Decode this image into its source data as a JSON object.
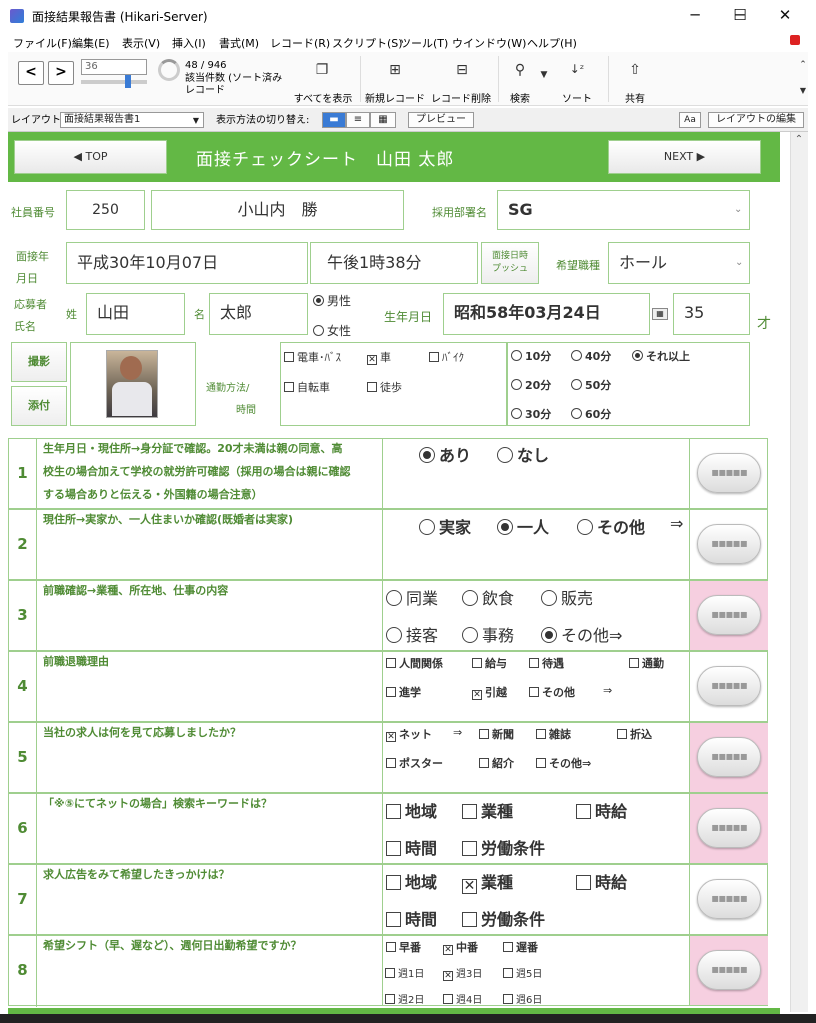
{
  "window": {
    "title": "面接結果報告書 (Hikari-Server)",
    "min": "─",
    "max": "☐",
    "close": "✕"
  },
  "menu": [
    "ファイル(F)",
    "編集(E)",
    "表示(V)",
    "挿入(I)",
    "書式(M)",
    "レコード(R)",
    "スクリプト(S)",
    "ツール(T)",
    "ウインドウ(W)",
    "ヘルプ(H)"
  ],
  "toolbar": {
    "prev": "<",
    "next": ">",
    "record_input": "36",
    "record_count": "48 / 946",
    "found_label": "該当件数 (ソート済み",
    "record_label": "レコード",
    "show_all": "すべてを表示",
    "new_record": "新規レコード",
    "delete_record": "レコード削除",
    "search": "検索",
    "sort": "ソート",
    "share": "共有"
  },
  "layoutbar": {
    "layout_label": "レイアウト:",
    "layout_value": "面接結果報告書1",
    "view_label": "表示方法の切り替え:",
    "preview": "プレビュー",
    "aa": "Aa",
    "edit_layout": "レイアウトの編集"
  },
  "header": {
    "top_btn": "◀ TOP",
    "title": "面接チェックシート　山田 太郎",
    "next_btn": "NEXT ▶"
  },
  "form": {
    "emp_no_label": "社員番号",
    "emp_no": "250",
    "interviewer": "小山内　勝",
    "dept_label": "採用部署名",
    "dept": "SG",
    "interview_date_label1": "面接年",
    "interview_date_label2": "月日",
    "interview_date": "平成30年10月07日",
    "interview_time": "午後1時38分",
    "push_btn1": "面接日時",
    "push_btn2": "プッシュ",
    "job_label": "希望職種",
    "job": "ホール",
    "applicant_label1": "応募者",
    "applicant_label2": "氏名",
    "sei_label": "姓",
    "sei": "山田",
    "mei_label": "名",
    "mei": "太郎",
    "male": "男性",
    "female": "女性",
    "birth_label": "生年月日",
    "birth": "昭和58年03月24日",
    "age": "35",
    "age_unit": "才",
    "photo_btn": "撮影",
    "attach_btn": "添付",
    "commute_label1": "通勤方法/",
    "commute_label2": "時間",
    "commute_opts": {
      "train": "電車･ﾊﾞｽ",
      "car": "車",
      "bike": "ﾊﾞｲｸ",
      "bicycle": "自転車",
      "walk": "徒歩"
    },
    "time_opts": {
      "m10": "10分",
      "m40": "40分",
      "more": "それ以上",
      "m20": "20分",
      "m50": "50分",
      "m30": "30分",
      "m60": "60分"
    }
  },
  "questions": [
    {
      "num": "1",
      "text1": "生年月日・現住所→身分証で確認。20才未満は親の同意、高",
      "text2": "校生の場合加えて学校の就労許可確認（採用の場合は親に確認",
      "text3": "する場合ありと伝える・外国籍の場合注意）",
      "a": "あり",
      "b": "なし"
    },
    {
      "num": "2",
      "text1": "現住所→実家か、一人住まいか確認(既婚者は実家)",
      "a": "実家",
      "b": "一人",
      "c": "その他",
      "arrow": "⇒"
    },
    {
      "num": "3",
      "text1": "前職確認→業種、所在地、仕事の内容",
      "a": "同業",
      "b": "飲食",
      "c": "販売",
      "d": "接客",
      "e": "事務",
      "f": "その他⇒"
    },
    {
      "num": "4",
      "text1": "前職退職理由",
      "a": "人間関係",
      "b": "給与",
      "c": "待遇",
      "d": "通勤",
      "e": "進学",
      "f": "引越",
      "g": "その他",
      "arrow": "⇒"
    },
    {
      "num": "5",
      "text1": "当社の求人は何を見て応募しましたか？",
      "a": "ネット",
      "arrow": "⇒",
      "b": "新聞",
      "c": "雑誌",
      "d": "折込",
      "e": "ポスター",
      "f": "紹介",
      "g": "その他⇒"
    },
    {
      "num": "6",
      "text1": "「※⑤にてネットの場合」検索キーワードは？",
      "a": "地域",
      "b": "業種",
      "c": "時給",
      "d": "時間",
      "e": "労働条件"
    },
    {
      "num": "7",
      "text1": "求人広告をみて希望したきっかけは？",
      "a": "地域",
      "b": "業種",
      "c": "時給",
      "d": "時間",
      "e": "労働条件"
    },
    {
      "num": "8",
      "text1": "希望シフト（早、遅など）、週何日出勤希望ですか？",
      "a": "早番",
      "b": "中番",
      "c": "遅番",
      "w1": "週1日",
      "w3": "週3日",
      "w5": "週5日",
      "w2": "週2日",
      "w4": "週4日",
      "w6": "週6日"
    }
  ],
  "memo_icon": "▪▪▪▪▪",
  "colors": {
    "accent": "#63b845",
    "label": "#4f8b34",
    "border": "#9fcf8e",
    "memo_pink": "#f6cfe0"
  }
}
